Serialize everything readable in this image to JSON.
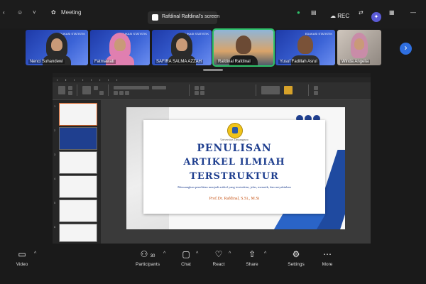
{
  "topbar": {
    "meeting_label": "Meeting",
    "share_label": "Rafdinal Rafdinal's screen",
    "rec_label": "REC"
  },
  "participants": [
    {
      "name": "Nenci Suhandewi",
      "tag": "EDUKASI STATISTIK"
    },
    {
      "name": "Fatmawati",
      "tag": "EDUKASI STATISTIK"
    },
    {
      "name": "SAFIRA SALMA AZZAH",
      "tag": "EDUKASI STATISTIK"
    },
    {
      "name": "Rafdinal Rafdinal",
      "tag": ""
    },
    {
      "name": "Yusuf Fadillah Asrul",
      "tag": "EDUKASI STATISTIK"
    },
    {
      "name": "Winda Angelia",
      "tag": ""
    }
  ],
  "slide": {
    "university": "Universitas Tanjungpura",
    "title_line1": "PENULISAN",
    "title_line2": "ARTIKEL ILMIAH",
    "title_line3": "TERSTRUKTUR",
    "subtitle": "Menuangkan penelitian menjadi artikel yang terstruktur, jelas, menarik, dan meyakinkan",
    "author": "Prof.Dr. Rafdinal, S.Si., M.Si"
  },
  "bottombar": {
    "video": "Video",
    "participants": "Participants",
    "participants_count": "30",
    "chat": "Chat",
    "react": "React",
    "share": "Share",
    "settings": "Settings",
    "more": "More"
  },
  "colors": {
    "accent": "#2f6fe0",
    "slide_blue": "#1f3f8f",
    "active_speaker": "#2ec26a"
  }
}
